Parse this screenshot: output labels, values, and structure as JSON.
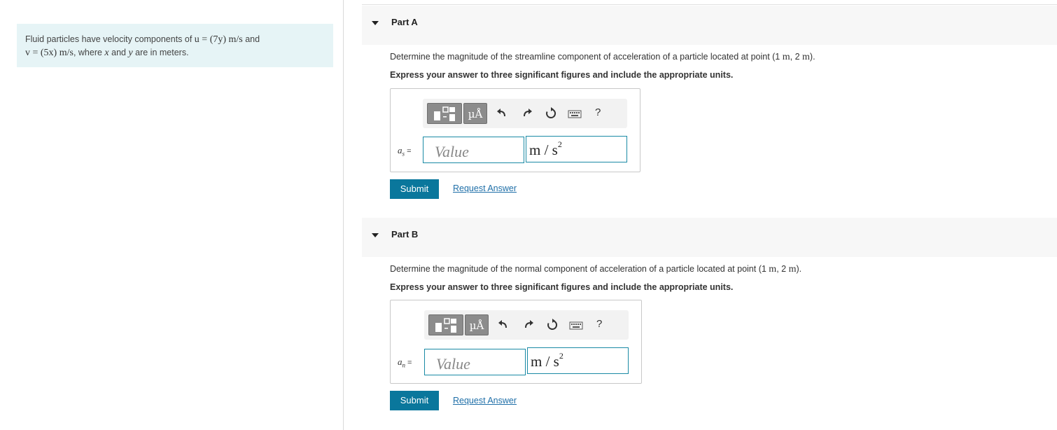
{
  "problem": {
    "text_1": "Fluid particles have velocity components of ",
    "u_expr": "u = (7y) m/s",
    "text_2": " and",
    "v_expr": "v = (5x) m/s",
    "text_3": ", where ",
    "x_var": "x",
    "text_4": " and ",
    "y_var": "y",
    "text_5": " are in meters."
  },
  "toolbar": {
    "units_label": "µÅ",
    "undo_icon": "undo-icon",
    "redo_icon": "redo-icon",
    "reset_icon": "reset-icon",
    "keyboard_icon": "keyboard-icon",
    "help_label": "?"
  },
  "parts": [
    {
      "title": "Part A",
      "question_pre": "Determine the magnitude of the streamline component of acceleration of a particle located at point (1 ",
      "unit_m1": "m",
      "question_mid": ", 2 ",
      "unit_m2": "m",
      "question_post": ").",
      "instruction": "Express your answer to three significant figures and include the appropriate units.",
      "variable": "a",
      "variable_sub": "s",
      "equals": " =",
      "value_placeholder": "Value",
      "unit_value": "m / s",
      "unit_exp": "2",
      "submit_label": "Submit",
      "request_label": "Request Answer"
    },
    {
      "title": "Part B",
      "question_pre": "Determine the magnitude of the normal component of acceleration of a particle located at point (1 ",
      "unit_m1": "m",
      "question_mid": ", 2 ",
      "unit_m2": "m",
      "question_post": ").",
      "instruction": "Express your answer to three significant figures and include the appropriate units.",
      "variable": "a",
      "variable_sub": "n",
      "equals": " =",
      "value_placeholder": "Value",
      "unit_value": "m / s",
      "unit_exp": "2",
      "submit_label": "Submit",
      "request_label": "Request Answer"
    }
  ],
  "colors": {
    "accent": "#0a779c",
    "input_border": "#1a8aa5",
    "problem_bg": "#e6f4f6",
    "link": "#1f6fa8"
  }
}
